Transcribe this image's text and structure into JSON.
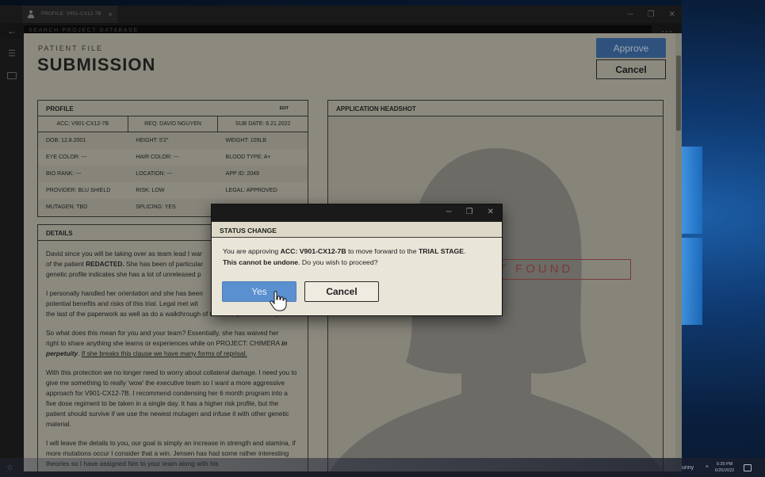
{
  "window": {
    "tab_title": "PROFILE: V901-CX12-7B",
    "tab_close": "×",
    "controls": [
      "─",
      "❐",
      "✕"
    ]
  },
  "address": {
    "back": "←",
    "placeholder": "SEARCH PROJECT DATABASE",
    "more": "···"
  },
  "sidebar": {
    "menu_glyph": "☰"
  },
  "header": {
    "eyebrow": "PATIENT FILE",
    "title": "SUBMISSION",
    "approve_label": "Approve",
    "cancel_label": "Cancel"
  },
  "profile": {
    "heading": "PROFILE",
    "edit": "EDIT",
    "acc": "ACC: V901-CX12-7B",
    "req": "REQ: DAVID NGUYEN",
    "sub_date": "SUB DATE: 6.21.2022",
    "rows": [
      [
        "DOB: 12.8.2001",
        "HEIGHT: 5'2\"",
        "WEIGHT: 109LB"
      ],
      [
        "EYE COLOR: ---",
        "HAIR COLOR: ---",
        "BLOOD TYPE: A+"
      ],
      [
        "BIO RANK: ---",
        "LOCATION: ---",
        "APP ID: 2049"
      ],
      [
        "PROVIDER: BLU SHIELD",
        "RISK: LOW",
        "LEGAL: APPROVED"
      ],
      [
        "MUTAGEN: TBD",
        "SPLICING: YES",
        ""
      ]
    ]
  },
  "details": {
    "heading": "DETAILS",
    "p1a": "David since you will be taking over as team lead I war",
    "p1b": "of the patient ",
    "p1b_bold": "REDACTED.",
    "p1c": " She has been of particular",
    "p1d": "genetic profile indicates she has a lot of unreleased p",
    "p2a": "I personally handled her orientation and she has been",
    "p2b": "potential benefits and risks of this trial.  Legal met wit",
    "p2c": "the last of the paperwork as well as do a walkthrough of the NDA (see attached).",
    "p3a": "So what does this mean for you and your team? Essentially, she has waived her",
    "p3b": "right to share anything she learns or experiences while on PROJECT: CHIMERA ",
    "p3b_bold": "in perpetuity",
    "p3c": ". ",
    "p3d": "If she breaks this clause we have many forms of reprisal.",
    "p4": "With this protection we no longer need to worry about collateral damage. I need you to give me something to really 'wow' the executive team so I want a more aggressive approach for V901-CX12-7B. I recommend condensing her 6 month program into a five dose regiment to be taken in a single day.  It has a higher risk profile, but the patient should survive if we use the newest mutagen and infuse it with other genetic material.",
    "p5": "I will leave the details to you, our goal is simply an increase in strength and stamina, if more mutations occur I consider that a win. Jensen has had some rather interesting theories so I have assigned him to your team along with his"
  },
  "headshot": {
    "heading": "APPLICATION HEADSHOT",
    "not_found": "T FOUND"
  },
  "modal": {
    "controls": [
      "─",
      "❐",
      "✕"
    ],
    "title": "STATUS CHANGE",
    "line1_pre": "You are approving ",
    "line1_bold1": "ACC: V901-CX12-7B",
    "line1_mid": " to move forward to the ",
    "line1_bold2": "TRIAL STAGE",
    "line1_end": ".",
    "line2_bold": "This cannot be undone",
    "line2_end": ". Do you wish to proceed?",
    "yes_label": "Yes",
    "cancel_label": "Cancel"
  },
  "taskbar": {
    "user": "unny",
    "chevron": "^",
    "time": "5:29 PM",
    "date": "6/25/2022",
    "star": "☆"
  }
}
